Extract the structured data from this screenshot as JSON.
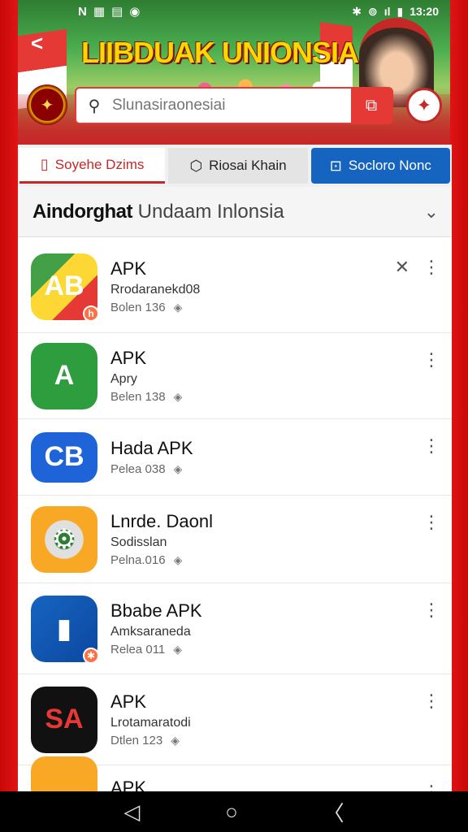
{
  "status_bar": {
    "left_icons": [
      "N",
      "▦",
      "▤",
      "◉"
    ],
    "right_icons": [
      "✱",
      "⊚",
      "ıl"
    ],
    "time": "13:20"
  },
  "header": {
    "title": "LIIBDUAK UNIONSIA",
    "search_placeholder": "Slunasiraonesiai",
    "back_icon": "back-arrow-icon"
  },
  "tabs": [
    {
      "label": "Soyehe Dzims",
      "icon": "phone-icon",
      "active": true
    },
    {
      "label": "Riosai Khain",
      "icon": "shield-icon",
      "active": false
    },
    {
      "label": "Socloro Nonc",
      "icon": "lock-icon",
      "active": false
    }
  ],
  "section": {
    "title_bold": "Aindorghat",
    "title_light": " Undaam Inlonsia"
  },
  "apps": [
    {
      "name": "APK",
      "subtitle": "Rrodaranekd08",
      "meta": "Bolen 136",
      "icon_text": "AB",
      "icon_class": "ic1",
      "has_close": true,
      "badge": "h"
    },
    {
      "name": "APK",
      "subtitle": "Apry",
      "meta": "Belen 138",
      "icon_text": "A",
      "icon_class": "ic2",
      "has_close": false,
      "badge": ""
    },
    {
      "name": "Hada APK",
      "subtitle": "",
      "meta": "Pelea 038",
      "icon_text": "CB",
      "icon_class": "ic3",
      "has_close": false,
      "badge": ""
    },
    {
      "name": "Lnrde. Daonl",
      "subtitle": "Sodisslan",
      "meta": "Pelna.016",
      "icon_text": "⚙",
      "icon_class": "ic4",
      "has_close": false,
      "badge": ""
    },
    {
      "name": "Bbabe APK",
      "subtitle": "Amksaraneda",
      "meta": "Relea 011",
      "icon_text": "▮",
      "icon_class": "ic5",
      "has_close": false,
      "badge": "✱"
    },
    {
      "name": "APK",
      "subtitle": "Lrotamaratodi",
      "meta": "Dtlen 123",
      "icon_text": "SA",
      "icon_class": "ic6",
      "has_close": false,
      "badge": ""
    },
    {
      "name": "APK",
      "subtitle": "",
      "meta": "",
      "icon_text": "",
      "icon_class": "ic7",
      "has_close": false,
      "badge": ""
    }
  ],
  "nav": {
    "back": "◁",
    "home": "○",
    "recent": "〈"
  }
}
